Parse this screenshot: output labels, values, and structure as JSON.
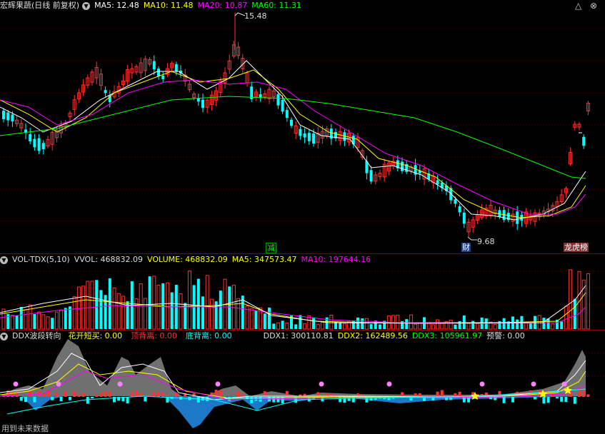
{
  "main": {
    "title": "宏辉果蔬(日线 前复权)",
    "ma": [
      {
        "label": "MA5: 12.48",
        "color": "#ffffff"
      },
      {
        "label": "MA10: 11.48",
        "color": "#ffff00"
      },
      {
        "label": "MA20: 10.87",
        "color": "#ff00ff"
      },
      {
        "label": "MA60: 11.31",
        "color": "#00ff00"
      }
    ],
    "high_label": "15.48",
    "low_label": "9.68",
    "tags": {
      "reduce": "减",
      "finance": "财",
      "board": "龙虎榜"
    }
  },
  "volume": {
    "indicator": "VOL-TDX(5,10)",
    "vvol": "VVOL: 468832.09",
    "volume": "VOLUME: 468832.09",
    "ma5": "MA5: 347573.47",
    "ma10": "MA10: 197644.16"
  },
  "ddx": {
    "indicator": "DDX波段转向",
    "buy": "花开短买: 0.00",
    "top": "顶背离: 0.00",
    "bottom": "底背离: 0.00",
    "ddx1": "DDX1: 300110.81",
    "ddx2": "DDX2: 162489.56",
    "ddx3": "DDX3: 105961.97",
    "warn": "预警: 0.00",
    "footer_note": "用到未来数据"
  },
  "colors": {
    "up": "#ff3232",
    "down": "#00ffff",
    "grid": "#8b0000"
  },
  "icons": [
    "chevron-down-icon",
    "triangle-icon",
    "close-icon"
  ]
}
